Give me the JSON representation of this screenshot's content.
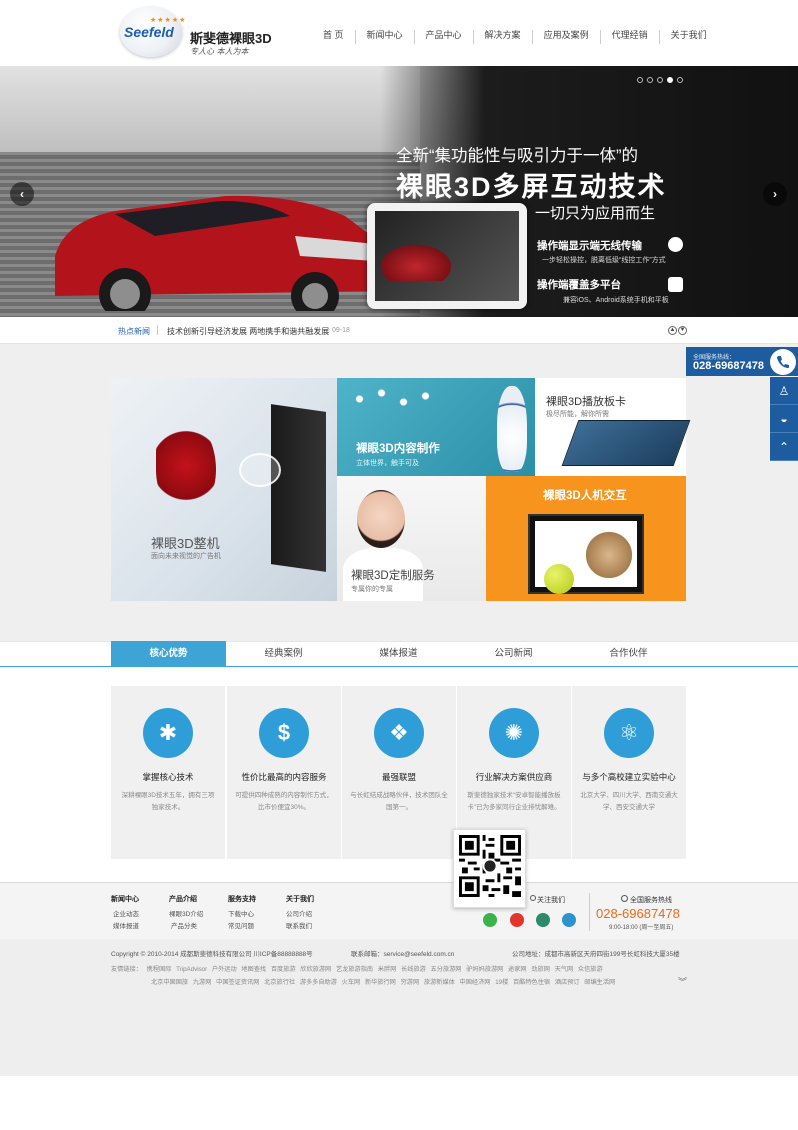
{
  "header": {
    "logo_text": "Seefeld",
    "logo_stars": "★★★★★",
    "brand": "斯斐德裸眼3D",
    "slogan": "专人心 本人为本"
  },
  "nav": {
    "items": [
      {
        "label": "首 页"
      },
      {
        "label": "新闻中心"
      },
      {
        "label": "产品中心"
      },
      {
        "label": "解决方案"
      },
      {
        "label": "应用及案例"
      },
      {
        "label": "代理经销"
      },
      {
        "label": "关于我们"
      }
    ]
  },
  "banner": {
    "line1": "全新“集功能性与吸引力于一体”的",
    "line2": "裸眼3D多屏互动技术",
    "line3": "一切只为应用而生",
    "feature1": "操作端显示端无线传输",
    "feature1_sub": "一步轻松操控，脱离低级“线控工作”方式",
    "feature2": "操作端覆盖多平台",
    "feature2_sub": "兼容iOS、Android系统手机和平板",
    "prev": "‹",
    "next": "›",
    "slide_count": 5,
    "active_slide": 4
  },
  "ticker": {
    "label": "热点新闻",
    "text": "技术创新引导经济发展 两地携手和谐共融发展",
    "date": "09-18",
    "up": "▲",
    "down": "▼"
  },
  "tiles": {
    "main_title": "裸眼3D整机",
    "main_sub": "面向未来视觉的广告机",
    "content_title": "裸眼3D内容制作",
    "content_sub": "立体世界，触手可及",
    "board_title": "裸眼3D播放板卡",
    "board_sub": "极尽所能，解你所需",
    "custom_title": "裸眼3D定制服务",
    "custom_sub": "专属你的专属",
    "hci_title": "裸眼3D人机交互"
  },
  "side": {
    "label": "全国服务热线：",
    "phone": "028-69687478",
    "phone_icon": "phone-icon",
    "qq_icon": "qq-icon",
    "chat_icon": "chat-icon",
    "top_icon": "back-to-top-icon"
  },
  "tabs": [
    {
      "label": "核心优势"
    },
    {
      "label": "经典案例"
    },
    {
      "label": "媒体报道"
    },
    {
      "label": "公司新闻"
    },
    {
      "label": "合作伙伴"
    }
  ],
  "advantages": [
    {
      "title": "掌握核心技术",
      "desc": "深耕裸眼3D技术五年，拥有三项独家技术。",
      "icon": "bulb-icon",
      "glyph": "✱"
    },
    {
      "title": "性价比最高的内容服务",
      "desc": "可提供四种成熟的内容制作方式，比市价便宜30%。",
      "icon": "dollar-icon",
      "glyph": "$"
    },
    {
      "title": "最强联盟",
      "desc": "与长虹结成战略伙伴，技术团队全国第一。",
      "icon": "handshake-icon",
      "glyph": "❖"
    },
    {
      "title": "行业解决方案供应商",
      "desc": "斯斐德独家技术“安卓智能播放板卡”已为多家同行企业排忧解难。",
      "icon": "gears-icon",
      "glyph": "✺"
    },
    {
      "title": "与多个高校建立实验中心",
      "desc": "北京大学、四川大学、西南交通大学、西安交通大学",
      "icon": "atom-icon",
      "glyph": "⚛"
    }
  ],
  "footer": {
    "cols": [
      {
        "title": "新闻中心",
        "items": [
          "企业动态",
          "媒体报道"
        ]
      },
      {
        "title": "产品介绍",
        "items": [
          "裸眼3D介绍",
          "产品分类"
        ]
      },
      {
        "title": "服务支持",
        "items": [
          "下载中心",
          "常见问题"
        ]
      },
      {
        "title": "关于我们",
        "items": [
          "公司介绍",
          "联系我们"
        ]
      }
    ],
    "follow": "关注我们",
    "hotline_label": "全国服务热线",
    "hotline": "028-69687478",
    "hours": "9:00-18:00 (周一至周五)",
    "copyright": "Copyright © 2010-2014 成都斯斐德科技有限公司  川ICP备88888888号",
    "email": "联系邮箱：service@seefeld.com.cn",
    "address": "公司地址：成都市高新区天府四街199号长虹科技大厦35楼",
    "links1": "友情链接： 携程国际  TripAdvisor  户外运动  地图查找  百度旅游  欣欣旅游网  艺龙旅游指南  米胖网  长线旅游  五分旅游网  驴妈妈旅游网  途家网  劲旅网  天气网  众信旅游",
    "links2": "北京中国国旅  九游网  中国签证资讯网  北京旅行社  游多多自助游  火车网  新华旅行网  穷游网  旅游新媒体  中国经济网  19楼  百酷特色住宿  酒店预订  邮编生活网",
    "expand": "︾"
  }
}
